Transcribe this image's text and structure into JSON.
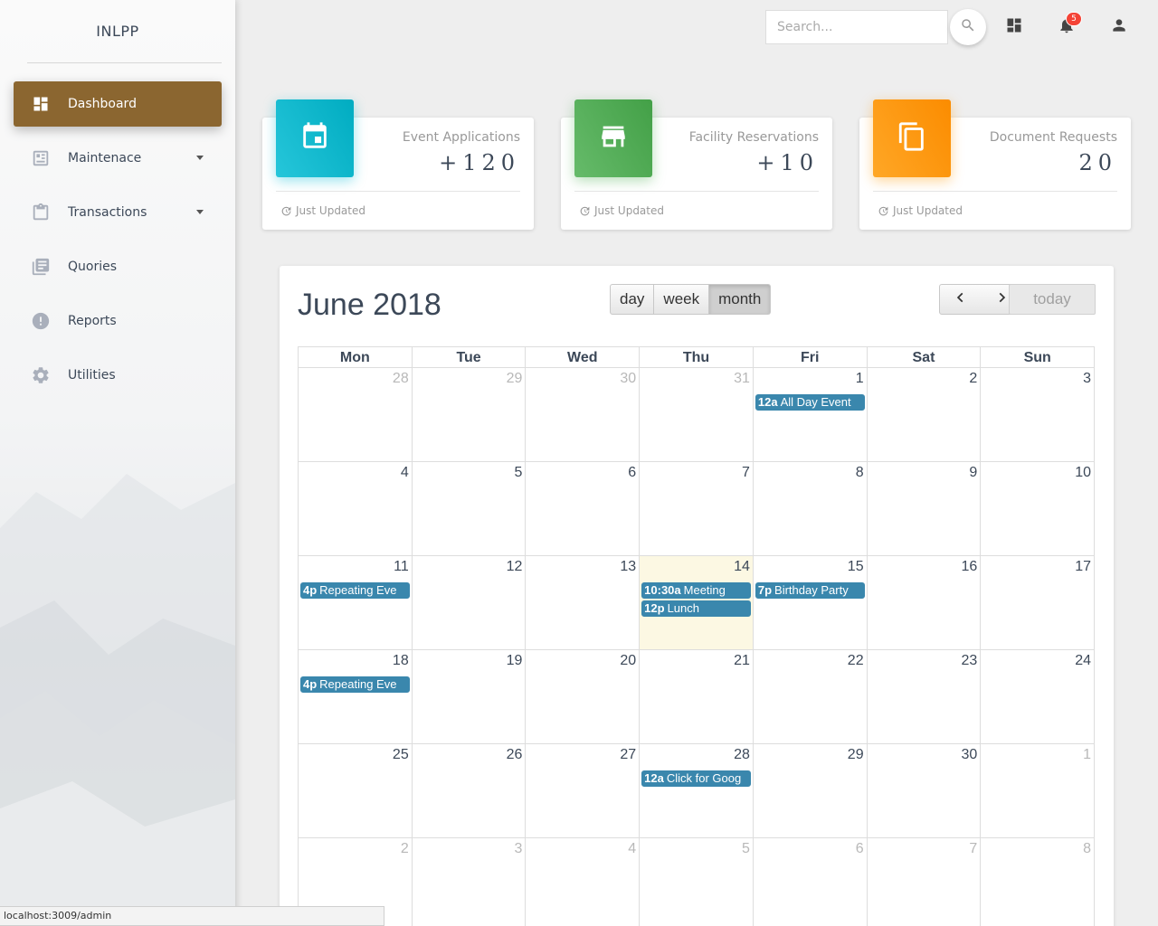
{
  "brand": "INLPP",
  "sidebar": {
    "items": [
      {
        "label": "Dashboard"
      },
      {
        "label": "Maintenace"
      },
      {
        "label": "Transactions"
      },
      {
        "label": "Quories"
      },
      {
        "label": "Reports"
      },
      {
        "label": "Utilities"
      }
    ]
  },
  "topbar": {
    "search_placeholder": "Search...",
    "notification_count": "5"
  },
  "cards": [
    {
      "title": "Event Applications",
      "value": "+120",
      "footer": "Just Updated",
      "color": "#00bcd4"
    },
    {
      "title": "Facility Reservations",
      "value": "+10",
      "footer": "Just Updated",
      "color": "#4caf50"
    },
    {
      "title": "Document Requests",
      "value": "20",
      "footer": "Just Updated",
      "color": "#ff9800"
    }
  ],
  "calendar": {
    "title": "June 2018",
    "view_buttons": {
      "day": "day",
      "week": "week",
      "month": "month"
    },
    "today_label": "today",
    "weekdays": [
      "Mon",
      "Tue",
      "Wed",
      "Thu",
      "Fri",
      "Sat",
      "Sun"
    ],
    "weeks": [
      [
        "28",
        "29",
        "30",
        "31",
        "1",
        "2",
        "3"
      ],
      [
        "4",
        "5",
        "6",
        "7",
        "8",
        "9",
        "10"
      ],
      [
        "11",
        "12",
        "13",
        "14",
        "15",
        "16",
        "17"
      ],
      [
        "18",
        "19",
        "20",
        "21",
        "22",
        "23",
        "24"
      ],
      [
        "25",
        "26",
        "27",
        "28",
        "29",
        "30",
        "1"
      ],
      [
        "2",
        "3",
        "4",
        "5",
        "6",
        "7",
        "8"
      ]
    ],
    "events": [
      {
        "time": "12a",
        "title": "All Day Event"
      },
      {
        "time": "4p",
        "title": "Repeating Eve"
      },
      {
        "time": "10:30a",
        "title": "Meeting"
      },
      {
        "time": "12p",
        "title": "Lunch"
      },
      {
        "time": "7p",
        "title": "Birthday Party"
      },
      {
        "time": "4p",
        "title": "Repeating Eve"
      },
      {
        "time": "12a",
        "title": "Click for Goog"
      }
    ]
  },
  "statusbar": "localhost:3009/admin"
}
